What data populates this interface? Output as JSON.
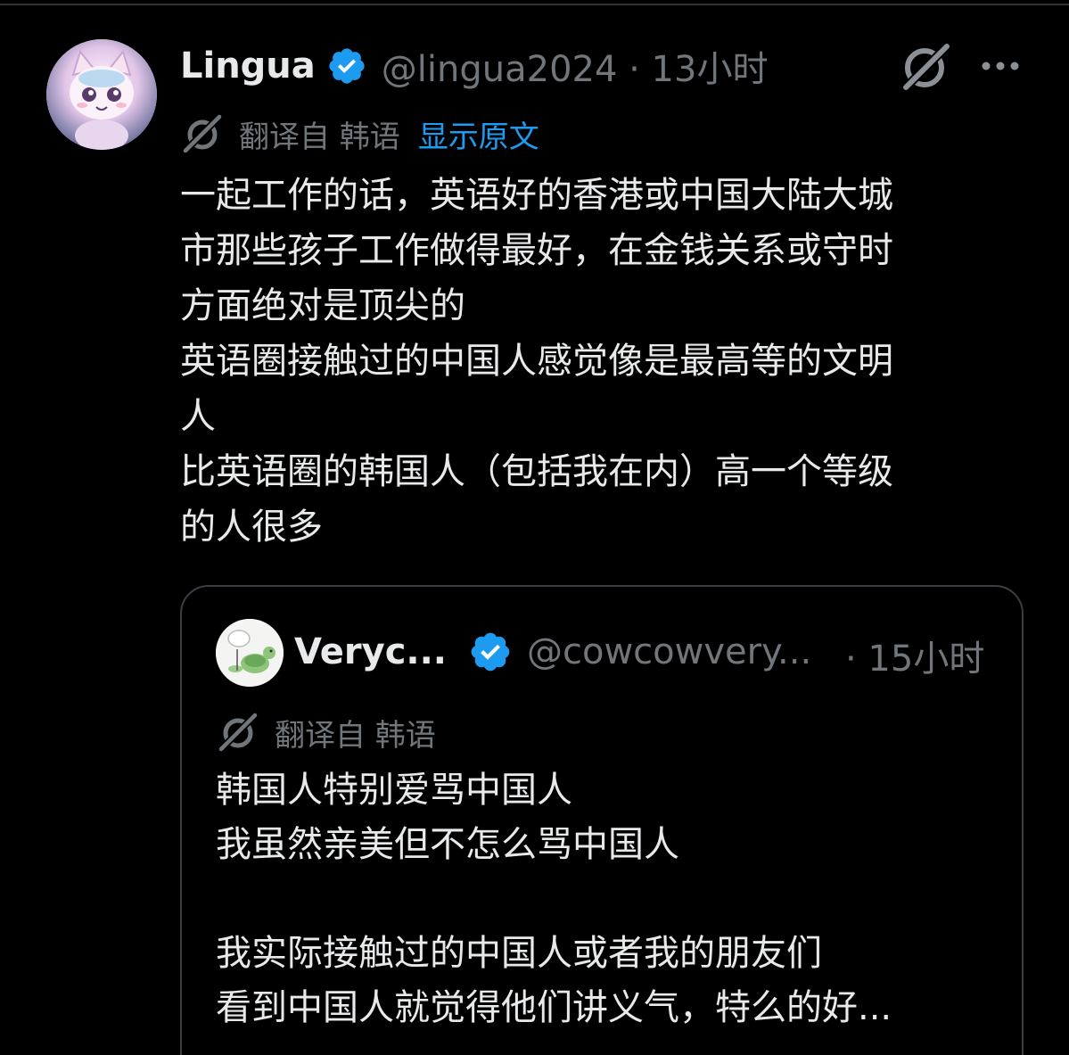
{
  "tweet": {
    "author": {
      "display_name": "Lingua",
      "handle_time": "@lingua2024 · 13小时",
      "verified": true
    },
    "translation": {
      "translated_from": "翻译自 韩语",
      "show_original": "显示原文"
    },
    "text_lines": [
      "一起工作的话，英语好的香港或中国大陆大城",
      "市那些孩子工作做得最好，在金钱关系或守时",
      "方面绝对是顶尖的",
      "英语圈接触过的中国人感觉像是最高等的文明",
      "人",
      "比英语圈的韩国人（包括我在内）高一个等级",
      "的人很多"
    ]
  },
  "quoted_tweet": {
    "author": {
      "display_name": "Veryc...",
      "handle": "@cowcowvery...",
      "time": "· 15小时",
      "verified": true
    },
    "translation": {
      "translated_from": "翻译自 韩语"
    },
    "text_lines": [
      "韩国人特别爱骂中国人",
      "我虽然亲美但不怎么骂中国人",
      "",
      "我实际接触过的中国人或者我的朋友们",
      "看到中国人就觉得他们讲义气，特么的好..."
    ]
  },
  "colors": {
    "background": "#000000",
    "text_primary": "#e7e9ea",
    "text_secondary": "#71767b",
    "link": "#1d9bf0",
    "verified_badge": "#1d9bf0",
    "border": "#3a3f44"
  },
  "icons": {
    "verified": "verified-badge-icon",
    "grok": "grok-icon",
    "more": "more-dots-icon",
    "translate": "grok-translate-icon"
  }
}
